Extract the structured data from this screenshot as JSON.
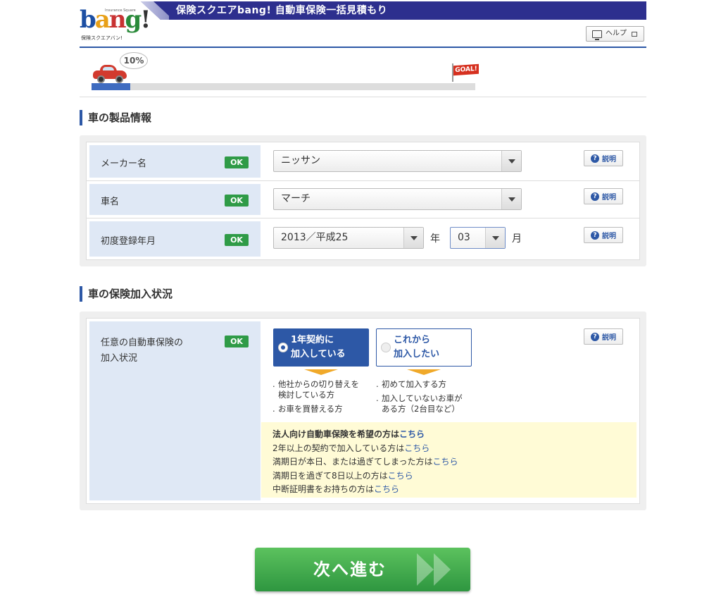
{
  "header": {
    "logo_word": [
      "b",
      "a",
      "n",
      "g",
      "!"
    ],
    "logo_sub": "保険スクエアバン!",
    "logo_tiny": "Insurance Square",
    "banner_title": "保険スクエアbang! 自動車保険一括見積もり",
    "help_label": "ヘルプ"
  },
  "progress": {
    "percent_label": "10%",
    "fraction": 0.1,
    "goal_label": "GOAL!"
  },
  "section_product": {
    "title": "車の製品情報",
    "rows": [
      {
        "label": "メーカー名",
        "status": "OK",
        "value": "ニッサン",
        "help": "説明"
      },
      {
        "label": "車名",
        "status": "OK",
        "value": "マーチ",
        "help": "説明"
      },
      {
        "label": "初度登録年月",
        "status": "OK",
        "year_value": "2013／平成25",
        "year_unit": "年",
        "month_value": "03",
        "month_unit": "月",
        "help": "説明"
      }
    ]
  },
  "section_insurance": {
    "title": "車の保険加入状況",
    "label_line1": "任意の自動車保険の",
    "label_line2": "加入状況",
    "status": "OK",
    "help": "説明",
    "option_yes": {
      "line1": "1年契約に",
      "line2": "加入している"
    },
    "option_no": {
      "line1": "これから",
      "line2": "加入したい"
    },
    "notes_yes": [
      "他社からの切り替えを",
      "検討している方",
      "お車を買替える方"
    ],
    "notes_no": [
      "初めて加入する方",
      "加入していないお車が",
      "ある方（2台目など）"
    ],
    "info": {
      "line1_text": "法人向け自動車保険を希望の方は",
      "line1_link": "こちら",
      "line2_text": "2年以上の契約で加入している方は",
      "line2_link": "こちら",
      "line3_text": "満期日が本日、または過ぎてしまった方は",
      "line3_link": "こちら",
      "line4_text": "満期日を過ぎて8日以上の方は",
      "line4_link": "こちら",
      "line5_text": "中断証明書をお持ちの方は",
      "line5_link": "こちら"
    }
  },
  "next_button": {
    "label": "次へ進む"
  },
  "icons": [
    "monitor-icon",
    "window-icon",
    "question-icon",
    "car-icon",
    "goal-flag-icon",
    "chevron-right-icon"
  ]
}
